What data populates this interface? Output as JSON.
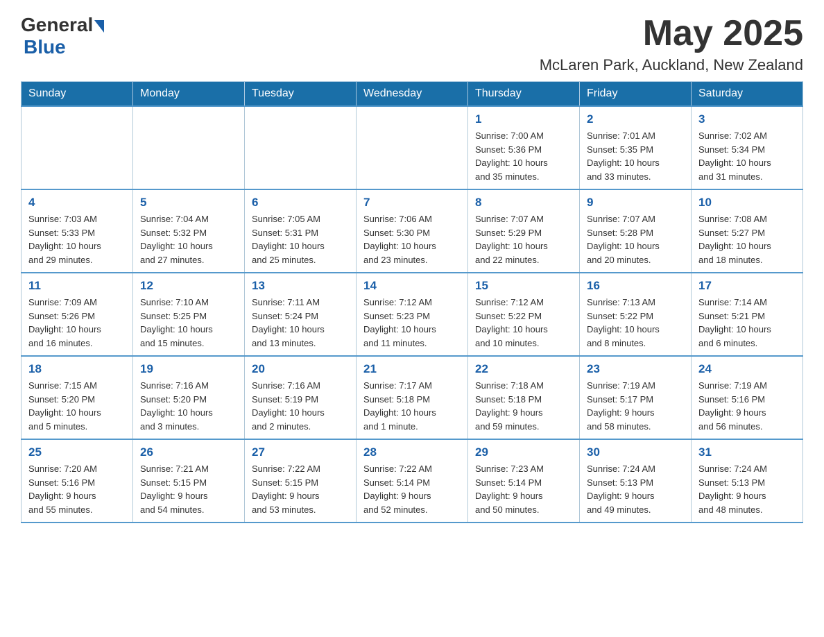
{
  "header": {
    "logo_general": "General",
    "logo_blue": "Blue",
    "month_title": "May 2025",
    "location": "McLaren Park, Auckland, New Zealand"
  },
  "weekdays": [
    "Sunday",
    "Monday",
    "Tuesday",
    "Wednesday",
    "Thursday",
    "Friday",
    "Saturday"
  ],
  "weeks": [
    [
      {
        "day": "",
        "info": ""
      },
      {
        "day": "",
        "info": ""
      },
      {
        "day": "",
        "info": ""
      },
      {
        "day": "",
        "info": ""
      },
      {
        "day": "1",
        "info": "Sunrise: 7:00 AM\nSunset: 5:36 PM\nDaylight: 10 hours\nand 35 minutes."
      },
      {
        "day": "2",
        "info": "Sunrise: 7:01 AM\nSunset: 5:35 PM\nDaylight: 10 hours\nand 33 minutes."
      },
      {
        "day": "3",
        "info": "Sunrise: 7:02 AM\nSunset: 5:34 PM\nDaylight: 10 hours\nand 31 minutes."
      }
    ],
    [
      {
        "day": "4",
        "info": "Sunrise: 7:03 AM\nSunset: 5:33 PM\nDaylight: 10 hours\nand 29 minutes."
      },
      {
        "day": "5",
        "info": "Sunrise: 7:04 AM\nSunset: 5:32 PM\nDaylight: 10 hours\nand 27 minutes."
      },
      {
        "day": "6",
        "info": "Sunrise: 7:05 AM\nSunset: 5:31 PM\nDaylight: 10 hours\nand 25 minutes."
      },
      {
        "day": "7",
        "info": "Sunrise: 7:06 AM\nSunset: 5:30 PM\nDaylight: 10 hours\nand 23 minutes."
      },
      {
        "day": "8",
        "info": "Sunrise: 7:07 AM\nSunset: 5:29 PM\nDaylight: 10 hours\nand 22 minutes."
      },
      {
        "day": "9",
        "info": "Sunrise: 7:07 AM\nSunset: 5:28 PM\nDaylight: 10 hours\nand 20 minutes."
      },
      {
        "day": "10",
        "info": "Sunrise: 7:08 AM\nSunset: 5:27 PM\nDaylight: 10 hours\nand 18 minutes."
      }
    ],
    [
      {
        "day": "11",
        "info": "Sunrise: 7:09 AM\nSunset: 5:26 PM\nDaylight: 10 hours\nand 16 minutes."
      },
      {
        "day": "12",
        "info": "Sunrise: 7:10 AM\nSunset: 5:25 PM\nDaylight: 10 hours\nand 15 minutes."
      },
      {
        "day": "13",
        "info": "Sunrise: 7:11 AM\nSunset: 5:24 PM\nDaylight: 10 hours\nand 13 minutes."
      },
      {
        "day": "14",
        "info": "Sunrise: 7:12 AM\nSunset: 5:23 PM\nDaylight: 10 hours\nand 11 minutes."
      },
      {
        "day": "15",
        "info": "Sunrise: 7:12 AM\nSunset: 5:22 PM\nDaylight: 10 hours\nand 10 minutes."
      },
      {
        "day": "16",
        "info": "Sunrise: 7:13 AM\nSunset: 5:22 PM\nDaylight: 10 hours\nand 8 minutes."
      },
      {
        "day": "17",
        "info": "Sunrise: 7:14 AM\nSunset: 5:21 PM\nDaylight: 10 hours\nand 6 minutes."
      }
    ],
    [
      {
        "day": "18",
        "info": "Sunrise: 7:15 AM\nSunset: 5:20 PM\nDaylight: 10 hours\nand 5 minutes."
      },
      {
        "day": "19",
        "info": "Sunrise: 7:16 AM\nSunset: 5:20 PM\nDaylight: 10 hours\nand 3 minutes."
      },
      {
        "day": "20",
        "info": "Sunrise: 7:16 AM\nSunset: 5:19 PM\nDaylight: 10 hours\nand 2 minutes."
      },
      {
        "day": "21",
        "info": "Sunrise: 7:17 AM\nSunset: 5:18 PM\nDaylight: 10 hours\nand 1 minute."
      },
      {
        "day": "22",
        "info": "Sunrise: 7:18 AM\nSunset: 5:18 PM\nDaylight: 9 hours\nand 59 minutes."
      },
      {
        "day": "23",
        "info": "Sunrise: 7:19 AM\nSunset: 5:17 PM\nDaylight: 9 hours\nand 58 minutes."
      },
      {
        "day": "24",
        "info": "Sunrise: 7:19 AM\nSunset: 5:16 PM\nDaylight: 9 hours\nand 56 minutes."
      }
    ],
    [
      {
        "day": "25",
        "info": "Sunrise: 7:20 AM\nSunset: 5:16 PM\nDaylight: 9 hours\nand 55 minutes."
      },
      {
        "day": "26",
        "info": "Sunrise: 7:21 AM\nSunset: 5:15 PM\nDaylight: 9 hours\nand 54 minutes."
      },
      {
        "day": "27",
        "info": "Sunrise: 7:22 AM\nSunset: 5:15 PM\nDaylight: 9 hours\nand 53 minutes."
      },
      {
        "day": "28",
        "info": "Sunrise: 7:22 AM\nSunset: 5:14 PM\nDaylight: 9 hours\nand 52 minutes."
      },
      {
        "day": "29",
        "info": "Sunrise: 7:23 AM\nSunset: 5:14 PM\nDaylight: 9 hours\nand 50 minutes."
      },
      {
        "day": "30",
        "info": "Sunrise: 7:24 AM\nSunset: 5:13 PM\nDaylight: 9 hours\nand 49 minutes."
      },
      {
        "day": "31",
        "info": "Sunrise: 7:24 AM\nSunset: 5:13 PM\nDaylight: 9 hours\nand 48 minutes."
      }
    ]
  ]
}
